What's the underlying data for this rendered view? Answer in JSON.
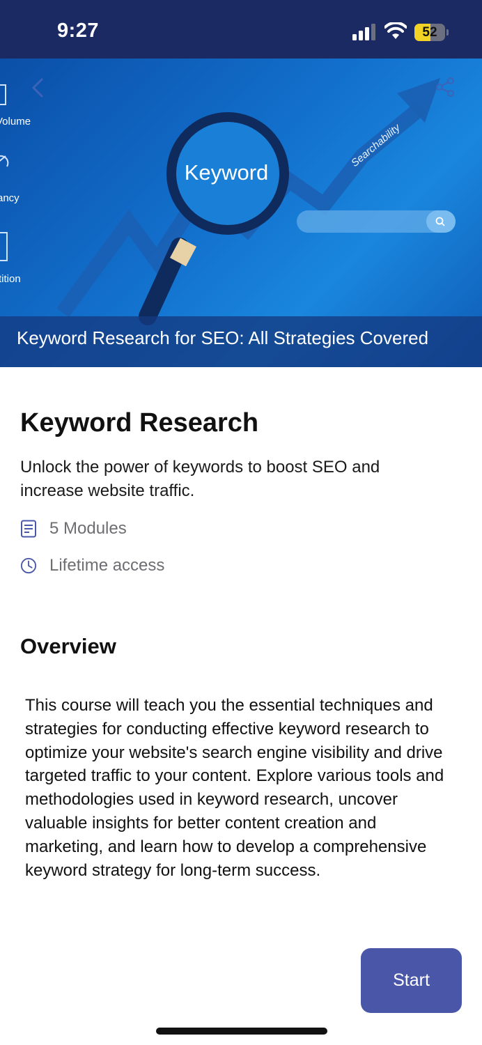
{
  "status_bar": {
    "time": "9:27",
    "battery_level": "52",
    "battery_fraction": 0.52,
    "battery_color": "#f2d224",
    "icons": [
      "signal-icon",
      "wifi-icon",
      "battery-icon"
    ]
  },
  "hero": {
    "side_labels": [
      "Volume",
      "ancy",
      "tition"
    ],
    "lens_text": "Keyword",
    "arrow_text": "Searchability",
    "caption": "Keyword Research for SEO: All Strategies Covered",
    "icons": [
      "back-icon",
      "share-icon",
      "magnifier-icon",
      "search-icon"
    ]
  },
  "course": {
    "title": "Keyword Research",
    "subtitle": "Unlock the power of keywords to boost SEO and increase website traffic.",
    "modules": "5 Modules",
    "access": "Lifetime access",
    "meta_icons": [
      "document-icon",
      "clock-icon"
    ],
    "meta_icon_color": "#4a57a8"
  },
  "overview": {
    "heading": "Overview",
    "body": "This course will teach you the essential techniques and strategies for conducting effective keyword research to optimize your website's search engine visibility and drive targeted traffic to your content. Explore various tools and methodologies used in keyword research, uncover valuable insights for better content creation and marketing, and learn how to develop a comprehensive keyword strategy for long-term success."
  },
  "actions": {
    "start_label": "Start",
    "accent_color": "#4a57a8"
  }
}
